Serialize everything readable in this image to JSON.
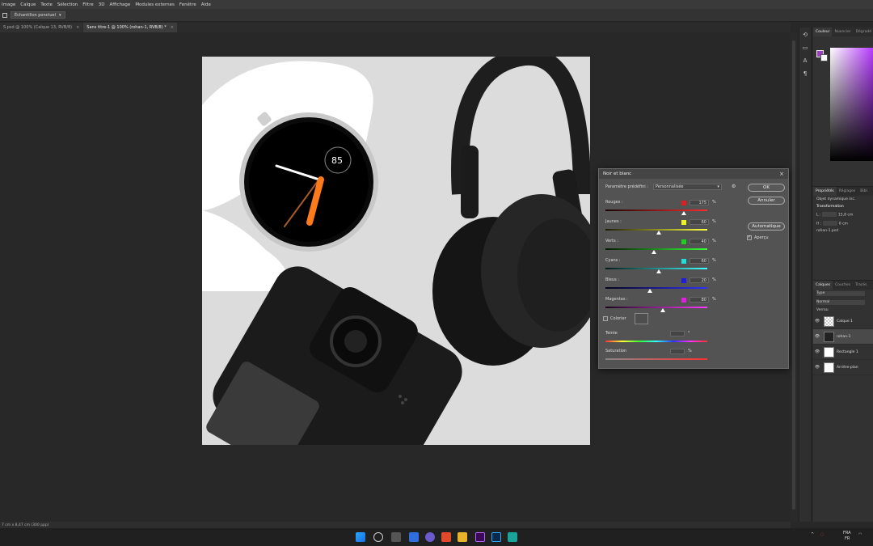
{
  "menubar": {
    "items": [
      "Image",
      "Calque",
      "Texte",
      "Sélection",
      "Filtre",
      "3D",
      "Affichage",
      "Modules externes",
      "Fenêtre",
      "Aide"
    ]
  },
  "options": {
    "sample_label": "Échantillon ponctuel"
  },
  "tabs": [
    {
      "label": "S.psd @ 100% (Calque 13, RVB/8)",
      "active": false
    },
    {
      "label": "Sans titre-1 @ 100% (rohan-1, RVB/8) *",
      "active": true
    }
  ],
  "status": {
    "text": "7 cm x 8,47 cm (300 ppp)"
  },
  "panels": {
    "top_tabs": [
      "Couleur",
      "Nuancier",
      "Dégradé"
    ],
    "props_tabs": [
      "Propriétés",
      "Réglages",
      "Bibl."
    ],
    "props_object": "Objet dynamique inc.",
    "transform_label": "Transformation",
    "w_label": "L :",
    "w_value": "15,8 cm",
    "h_label": "H :",
    "x_value": "0 cm",
    "filename": "rohan-1.psd",
    "layers_tabs": [
      "Calques",
      "Couches",
      "Tracés"
    ],
    "search_placeholder": "Type",
    "blend_mode": "Normal",
    "lock_label": "Verrou",
    "layers": [
      {
        "name": "Calque 1",
        "thumb": "checker",
        "selected": false
      },
      {
        "name": "rohan-1",
        "thumb": "dark",
        "selected": true
      },
      {
        "name": "Rectangle 1",
        "thumb": "white",
        "selected": false
      },
      {
        "name": "Arrière-plan",
        "thumb": "white",
        "selected": false
      }
    ]
  },
  "dialog": {
    "title": "Noir et blanc",
    "preset_label": "Paramètre prédéfini :",
    "preset_value": "Personnalisée",
    "ok": "OK",
    "cancel": "Annuler",
    "auto": "Automatique",
    "preview": "Aperçu",
    "colorize": "Colorier",
    "tint": "Teinte",
    "saturation": "Saturation",
    "sliders": [
      {
        "label": "Rouges :",
        "value": "175",
        "fraction": 0.77,
        "chip": "#e21c1c",
        "track": "linear-gradient(to right,#1a0404,#ff2a2a)"
      },
      {
        "label": "Jaunes :",
        "value": "60",
        "fraction": 0.52,
        "chip": "#f2f21c",
        "track": "linear-gradient(to right,#1c1c04,#ffff40)"
      },
      {
        "label": "Verts :",
        "value": "40",
        "fraction": 0.48,
        "chip": "#1cd01c",
        "track": "linear-gradient(to right,#041a04,#38ff38)"
      },
      {
        "label": "Cyans :",
        "value": "60",
        "fraction": 0.52,
        "chip": "#1ce0e0",
        "track": "linear-gradient(to right,#041a1a,#40ffff)"
      },
      {
        "label": "Bleus :",
        "value": "20",
        "fraction": 0.44,
        "chip": "#1c1ce2",
        "track": "linear-gradient(to right,#04041a,#3030ff)"
      },
      {
        "label": "Magentas :",
        "value": "80",
        "fraction": 0.56,
        "chip": "#e21ce2",
        "track": "linear-gradient(to right,#1a041a,#ff38ff)"
      }
    ],
    "pct": "%"
  },
  "taskbar": {
    "lang": "FRA",
    "lang2": "FR"
  }
}
